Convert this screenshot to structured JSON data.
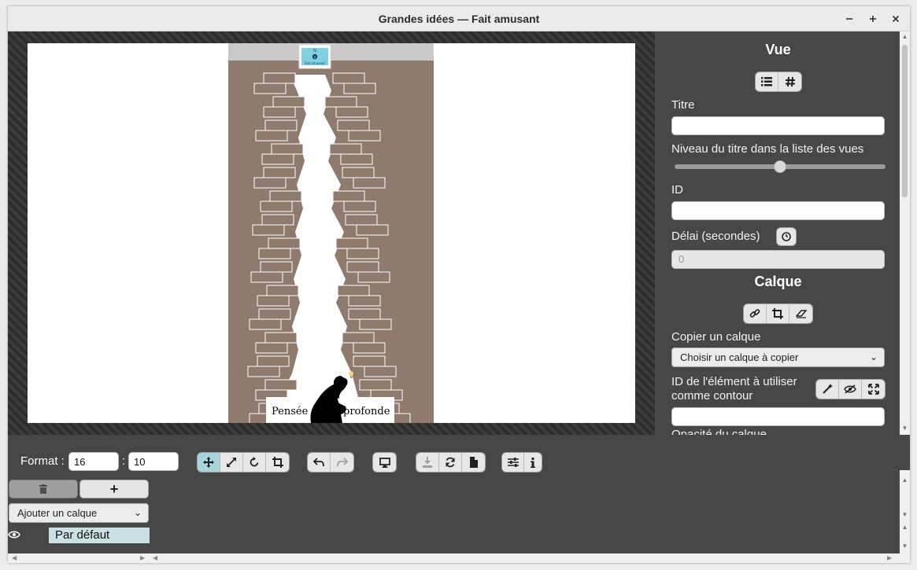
{
  "window": {
    "title": "Grandes idées — Fait amusant",
    "controls": [
      "minimize-icon",
      "maximize-icon",
      "close-icon"
    ]
  },
  "slide": {
    "caption_left": "Pensée",
    "caption_right": "profonde",
    "badge_text": "Fait amusant",
    "badge_top": "N",
    "wall_color": "#8f7a6e",
    "header_color": "#c9c9c9"
  },
  "panel": {
    "vue_heading": "Vue",
    "vue_mode_icons": [
      "list-icon",
      "hash-icon"
    ],
    "titre_label": "Titre",
    "titre_value": "",
    "niveau_label": "Niveau du titre dans la liste des vues",
    "niveau_level": 0.5,
    "id_label": "ID",
    "id_value": "",
    "delai_label": "Délai (secondes)",
    "delai_placeholder": "0",
    "calque_heading": "Calque",
    "calque_tool_icons": [
      "link-icon",
      "crop-icon",
      "eraser-icon"
    ],
    "copier_label": "Copier un calque",
    "copier_select": "Choisir un calque à copier",
    "element_id_label_1": "ID de l'élément à utiliser",
    "element_id_label_2": "comme contour",
    "element_id_value": "",
    "element_tool_icons": [
      "magic-wand-icon",
      "eye-slash-icon",
      "expand-icon"
    ],
    "opacity_label": "Opacité du calque"
  },
  "toolbar": {
    "format_label": "Format :",
    "format_width": "16",
    "format_sep": ":",
    "format_height": "10",
    "transform_icons": [
      "move-icon",
      "resize-icon",
      "rotate-icon",
      "crop-icon"
    ],
    "history_icons": [
      "undo-icon",
      "redo-icon"
    ],
    "present_icon": "monitor-icon",
    "file_icons": [
      "download-icon",
      "refresh-icon",
      "file-icon"
    ],
    "info_icons": [
      "sliders-icon",
      "info-icon"
    ]
  },
  "layers": {
    "delete_icon": "trash-icon",
    "add_label": "+",
    "add_layer_select": "Ajouter un calque",
    "items": [
      {
        "label": "Par défaut",
        "visible": true
      }
    ]
  },
  "colors": {
    "active_tool": "#a8d6dc",
    "panel_bg": "#474747",
    "layer_selected": "#c9e0e4"
  }
}
